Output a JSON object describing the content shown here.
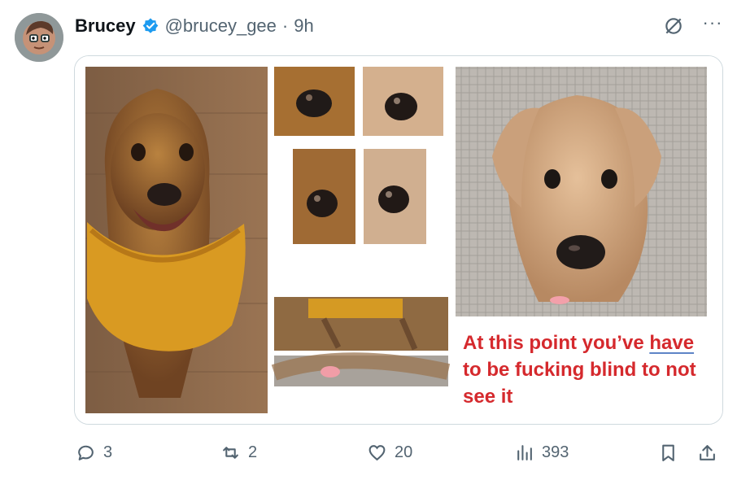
{
  "tweet": {
    "author": {
      "display_name": "Brucey",
      "handle": "@brucey_gee",
      "separator": "·",
      "time": "9h"
    },
    "top_icons": {
      "edit_icon": "slashed-circle-icon",
      "more_label": "···"
    },
    "media": {
      "caption_before": "At this point you’ve ",
      "caption_underlined": "have",
      "caption_after": " to be fucking blind to not see it"
    },
    "actions": {
      "reply_count": "3",
      "retweet_count": "2",
      "like_count": "20",
      "view_count": "393"
    },
    "colors": {
      "verified_blue": "#1d9bf0",
      "caption_red": "#d5292d",
      "muted_gray": "#536471"
    }
  }
}
